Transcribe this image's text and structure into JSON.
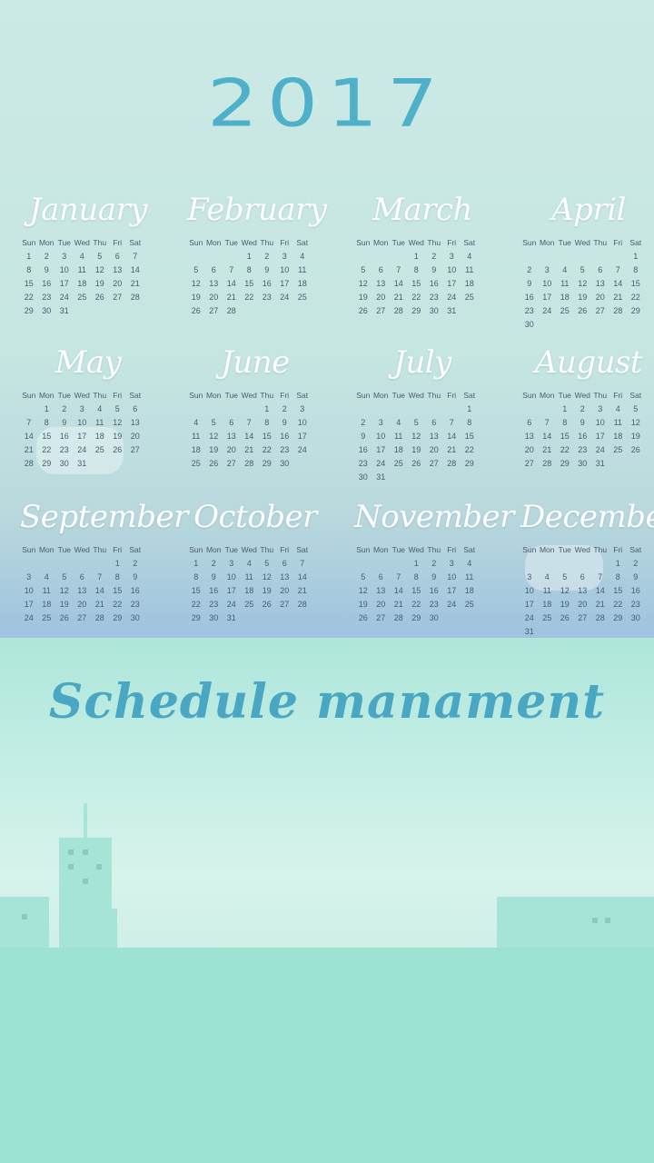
{
  "year": "2017",
  "tagline": "Schedule manament",
  "weekday_labels": [
    "Sun",
    "Mon",
    "Tue",
    "Wed",
    "Thu",
    "Fri",
    "Sat"
  ],
  "months": [
    {
      "name": "January",
      "start": 0,
      "days": 31
    },
    {
      "name": "February",
      "start": 3,
      "days": 28
    },
    {
      "name": "March",
      "start": 3,
      "days": 31
    },
    {
      "name": "April",
      "start": 6,
      "days": 30
    },
    {
      "name": "May",
      "start": 1,
      "days": 31
    },
    {
      "name": "June",
      "start": 4,
      "days": 30
    },
    {
      "name": "July",
      "start": 6,
      "days": 31
    },
    {
      "name": "August",
      "start": 2,
      "days": 31
    },
    {
      "name": "September",
      "start": 5,
      "days": 30
    },
    {
      "name": "October",
      "start": 0,
      "days": 31
    },
    {
      "name": "November",
      "start": 3,
      "days": 30
    },
    {
      "name": "December",
      "start": 5,
      "days": 31
    }
  ]
}
